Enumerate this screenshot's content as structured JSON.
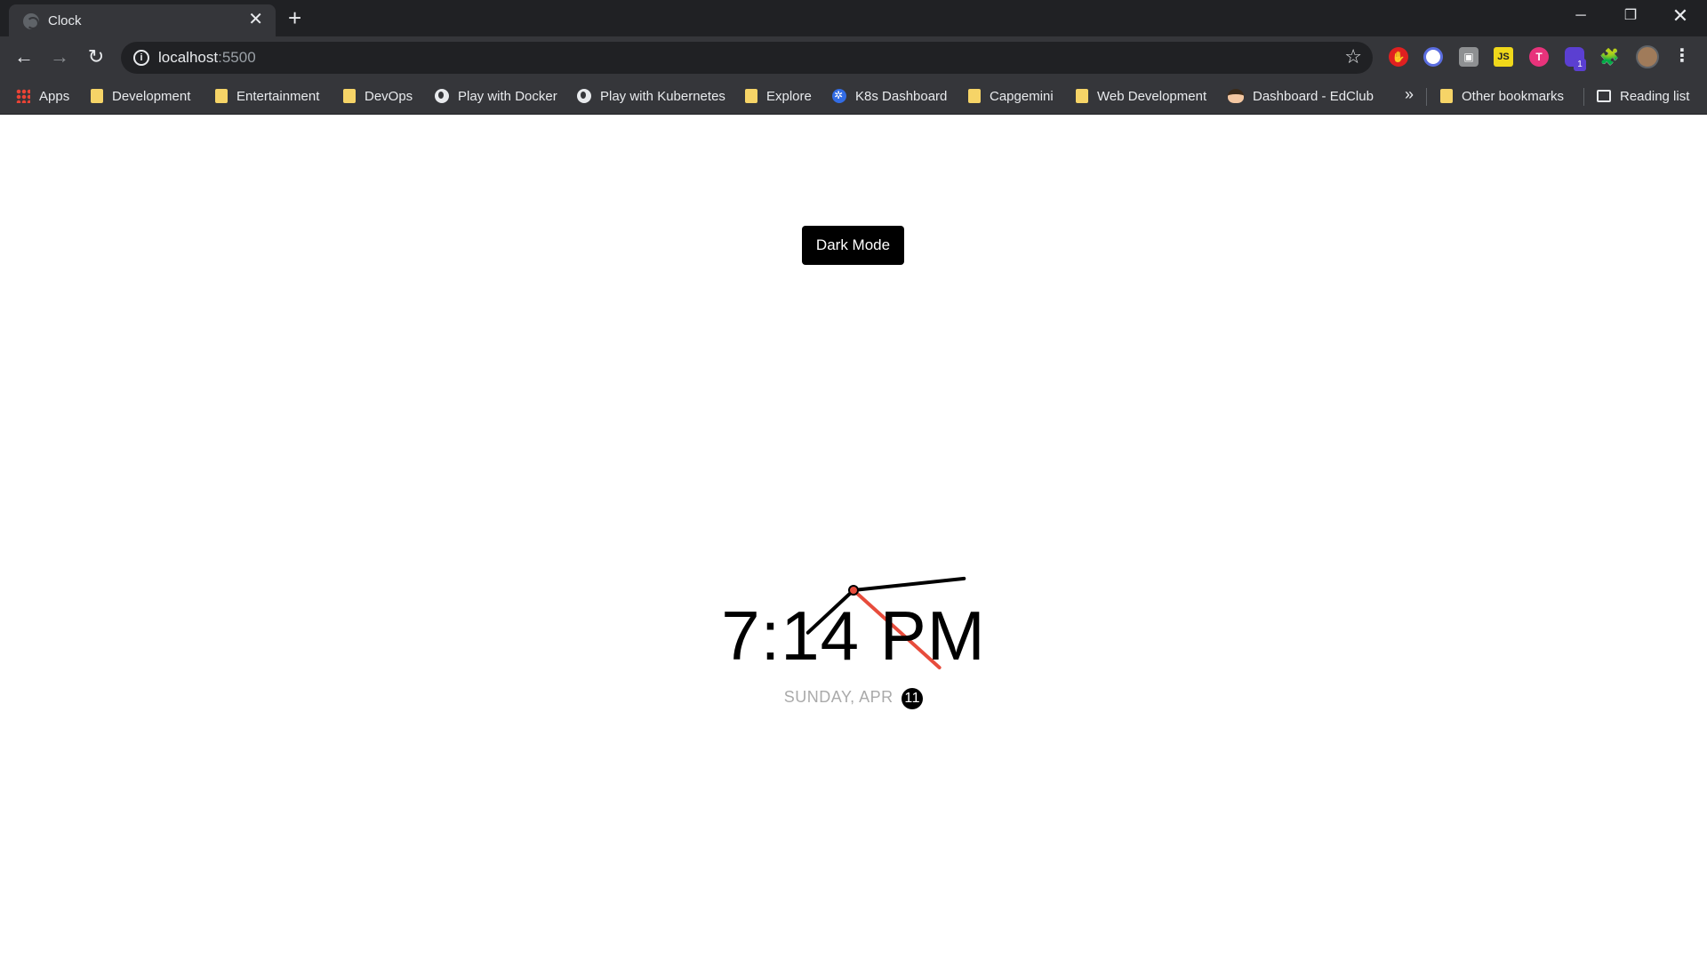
{
  "tab": {
    "title": "Clock",
    "close_glyph": "✕"
  },
  "new_tab_glyph": "+",
  "window_controls": {
    "minimize": "─",
    "maximize": "❐",
    "close": "✕"
  },
  "toolbar": {
    "back_glyph": "←",
    "forward_glyph": "→",
    "reload_glyph": "↻",
    "url_host": "localhost",
    "url_port": ":5500",
    "star_glyph": "☆",
    "menu_glyph": "⋮"
  },
  "extensions": [
    {
      "name": "red-hand-icon",
      "glyph": "✋"
    },
    {
      "name": "block-icon",
      "glyph": ""
    },
    {
      "name": "gray-square-icon",
      "glyph": "▣"
    },
    {
      "name": "js-icon",
      "glyph": "JS"
    },
    {
      "name": "pink-t-icon",
      "glyph": "T"
    },
    {
      "name": "purple-icon",
      "glyph": ""
    }
  ],
  "extension_badge": "1",
  "puzzle_glyph": "🧩",
  "bookmarks": {
    "apps": "Apps",
    "items": [
      "Development",
      "Entertainment",
      "DevOps",
      "Play with Docker",
      "Play with Kubernetes",
      "Explore",
      "K8s Dashboard",
      "Capgemini",
      "Web Development",
      "Dashboard - EdClub"
    ],
    "more": "»",
    "other": "Other bookmarks",
    "reading": "Reading list"
  },
  "page": {
    "mode_button": "Dark Mode",
    "time": "7:14 PM",
    "date_text": "SUNDAY, APR ",
    "date_day": "11"
  },
  "clock": {
    "hour_hand_angle_deg": 227,
    "minute_hand_angle_deg": 84,
    "second_hand_angle_deg": 132,
    "hand_color": "#000000",
    "second_hand_color": "#e74c3c"
  },
  "colors": {
    "titlebar": "#202124",
    "toolbar": "#35363a",
    "omnibox": "#202124",
    "page_bg": "#ffffff",
    "date_text": "#aaaaaa"
  }
}
